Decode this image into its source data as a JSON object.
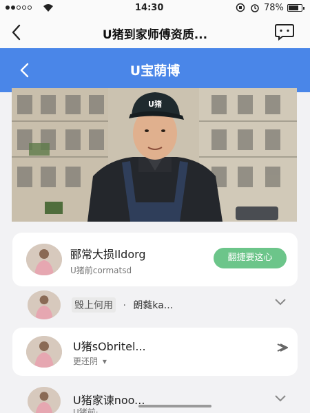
{
  "status_bar": {
    "time": "14:30",
    "battery_percent": "78%",
    "battery_level": 0.78
  },
  "nav": {
    "title": "U猪到家师傅资质...",
    "back_icon": "chevron-left-icon",
    "chat_icon": "chat-bubble-icon"
  },
  "banner": {
    "title": "U宝荫博",
    "color": "#4a86e8"
  },
  "hero": {
    "cap_text": "U猪"
  },
  "list": [
    {
      "title": "郦常大损Ildorg",
      "subtitle": "U猪前cormatsd",
      "action_label": "翻捷要这心",
      "action_color": "#6cc58a"
    },
    {
      "title": "毁上何用",
      "separator": "·",
      "subtitle": "朗蕤ka..."
    },
    {
      "title": "U猪sObritel...",
      "subtitle": "更还阴",
      "sub_suffix": "▾"
    },
    {
      "title": "U猪家谏noo...",
      "subtitle": "U猪前·..."
    }
  ]
}
